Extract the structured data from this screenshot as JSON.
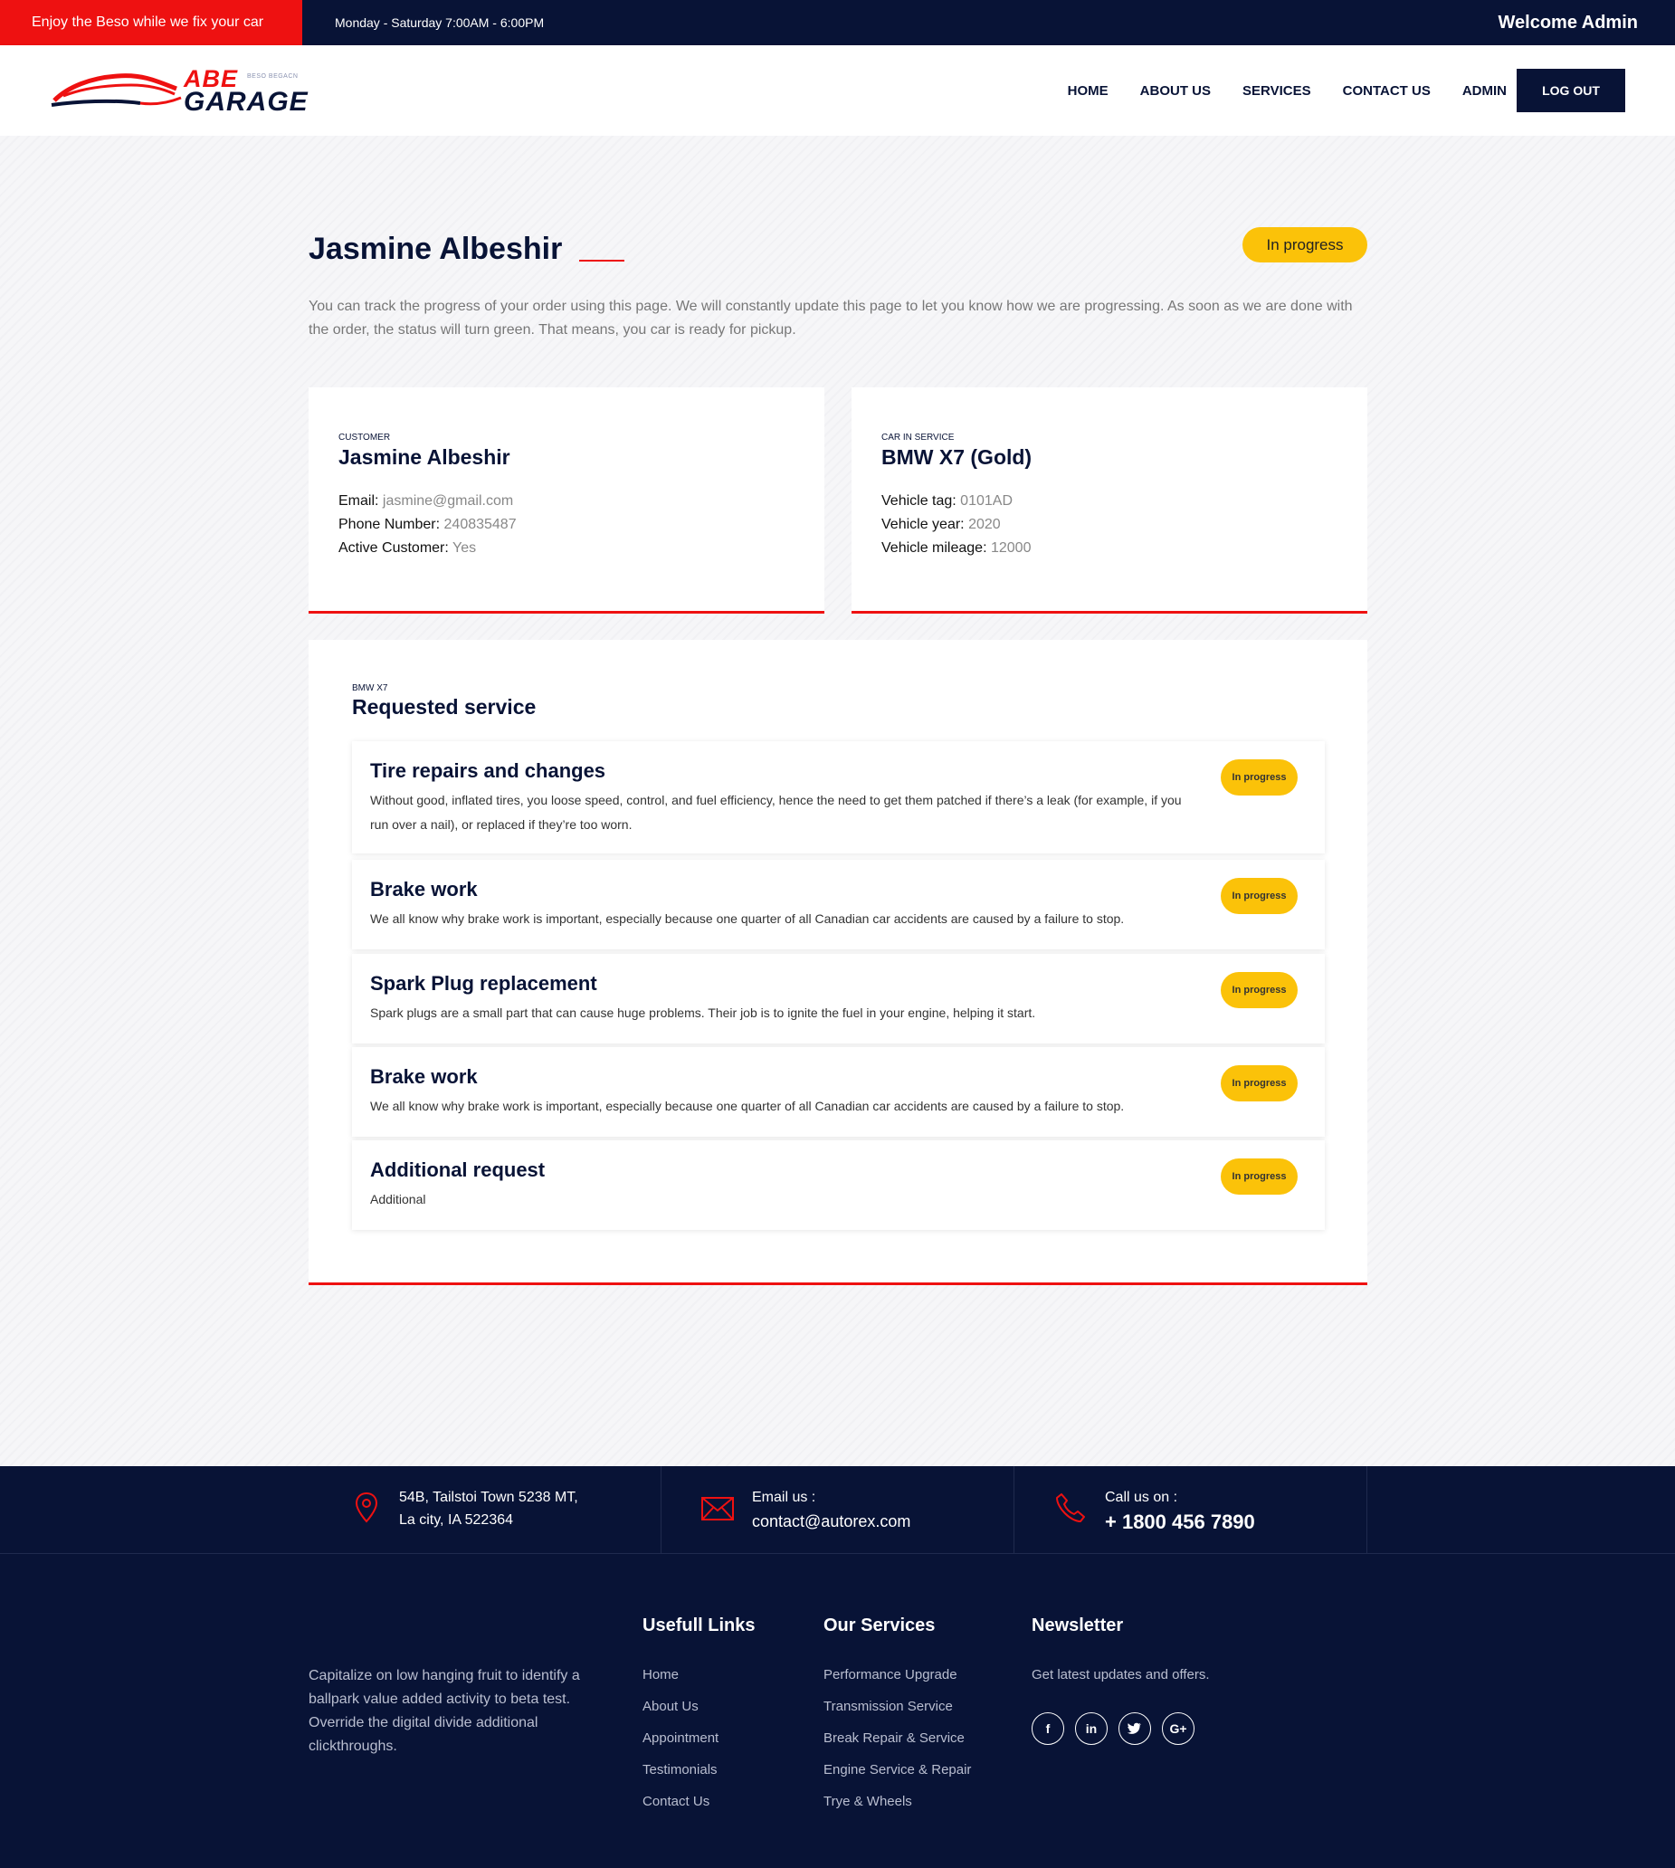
{
  "topbar": {
    "promo": "Enjoy the Beso while we fix your car",
    "hours": "Monday - Saturday 7:00AM - 6:00PM",
    "welcome": "Welcome Admin"
  },
  "logo": {
    "abe": "ABE",
    "tag": "BESO BEGACN",
    "garage": "GARAGE"
  },
  "nav": {
    "items": [
      "HOME",
      "ABOUT US",
      "SERVICES",
      "CONTACT US",
      "ADMIN"
    ],
    "logout": "LOG OUT"
  },
  "order": {
    "title": "Jasmine Albeshir",
    "status": "In progress",
    "intro": "You can track the progress of your order using this page. We will constantly update this page to let you know how we are progressing. As soon as we are done with the order, the status will turn green. That means, you car is ready for pickup.",
    "status_color": "#fbc209"
  },
  "customer": {
    "label": "CUSTOMER",
    "name": "Jasmine Albeshir",
    "fields": [
      {
        "key": "Email",
        "value": "jasmine@gmail.com"
      },
      {
        "key": "Phone Number",
        "value": "240835487"
      },
      {
        "key": "Active Customer",
        "value": "Yes"
      }
    ]
  },
  "vehicle": {
    "label": "CAR IN SERVICE",
    "name": "BMW X7 (Gold)",
    "fields": [
      {
        "key": "Vehicle tag",
        "value": "0101AD"
      },
      {
        "key": "Vehicle year",
        "value": "2020"
      },
      {
        "key": "Vehicle mileage",
        "value": "12000"
      }
    ]
  },
  "services": {
    "label": "BMW X7",
    "title": "Requested service",
    "items": [
      {
        "name": "Tire repairs and changes",
        "desc": "Without good, inflated tires, you loose speed, control, and fuel efficiency, hence the need to get them patched if there’s a leak (for example, if you run over a nail), or replaced if they’re too worn.",
        "status": "In progress"
      },
      {
        "name": "Brake work",
        "desc": "We all know why brake work is important, especially because one quarter of all Canadian car accidents are caused by a failure to stop.",
        "status": "In progress"
      },
      {
        "name": "Spark Plug replacement",
        "desc": "Spark plugs are a small part that can cause huge problems. Their job is to ignite the fuel in your engine, helping it start.",
        "status": "In progress"
      },
      {
        "name": "Brake work",
        "desc": "We all know why brake work is important, especially because one quarter of all Canadian car accidents are caused by a failure to stop.",
        "status": "In progress"
      },
      {
        "name": "Additional request",
        "desc": "Additional",
        "status": "In progress"
      }
    ]
  },
  "contact": {
    "address_line1": "54B, Tailstoi Town 5238 MT,",
    "address_line2": "La city, IA 522364",
    "email_label": "Email us :",
    "email": "contact@autorex.com",
    "phone_label": "Call us on :",
    "phone": "+ 1800 456 7890"
  },
  "footer": {
    "about": "Capitalize on low hanging fruit to identify a ballpark value added activity to beta test. Override the digital divide additional clickthroughs.",
    "links_title": "Usefull Links",
    "links": [
      "Home",
      "About Us",
      "Appointment",
      "Testimonials",
      "Contact Us"
    ],
    "services_title": "Our Services",
    "services": [
      "Performance Upgrade",
      "Transmission Service",
      "Break Repair & Service",
      "Engine Service & Repair",
      "Trye & Wheels"
    ],
    "newsletter_title": "Newsletter",
    "newsletter_text": "Get latest updates and offers.",
    "socials": [
      "facebook-icon",
      "linkedin-icon",
      "twitter-icon",
      "google-plus-icon"
    ]
  },
  "colors": {
    "navy": "#081336",
    "red": "#ee1111",
    "yellow": "#fbc209"
  }
}
